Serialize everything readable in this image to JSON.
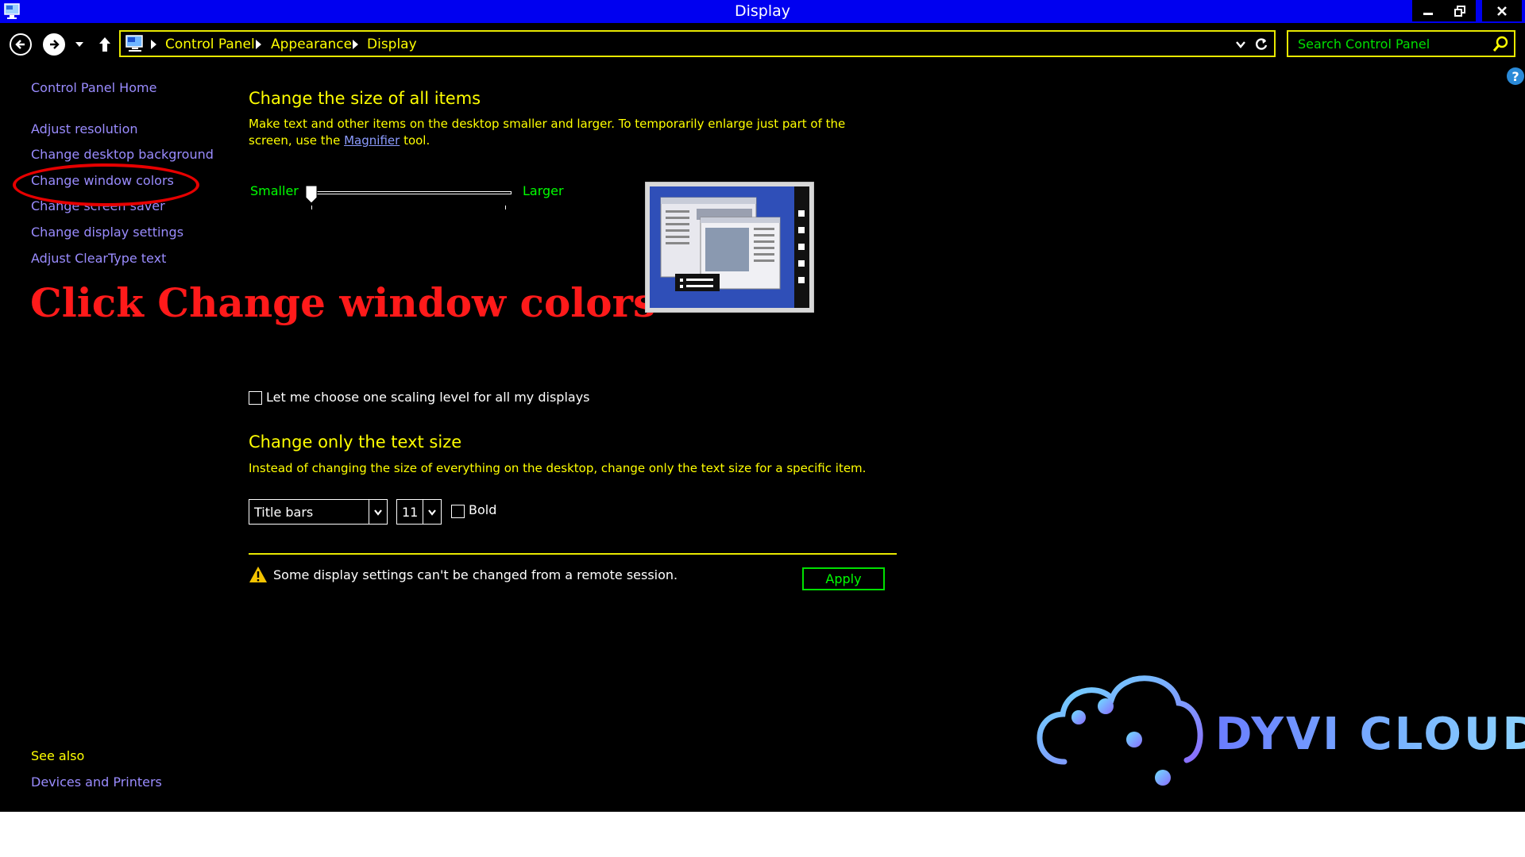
{
  "window": {
    "title": "Display",
    "controls": {
      "minimize": "minimize",
      "maximize": "restore",
      "close": "close"
    }
  },
  "navigation": {
    "breadcrumb": [
      "Control Panel",
      "Appearance",
      "Display"
    ],
    "search_placeholder": "Search Control Panel"
  },
  "sidebar": {
    "home": "Control Panel Home",
    "links": [
      "Adjust resolution",
      "Change desktop background",
      "Change window colors",
      "Change screen saver",
      "Change display settings",
      "Adjust ClearType text"
    ],
    "see_also_heading": "See also",
    "see_also_links": [
      "Devices and Printers"
    ]
  },
  "annotation": {
    "callout": "Click Change window colors",
    "highlight_color": "#e60000"
  },
  "main": {
    "size_section": {
      "heading": "Change the size of all items",
      "description_before": "Make text and other items on the desktop smaller and larger. To temporarily enlarge just part of the screen, use the ",
      "magnifier_link": "Magnifier",
      "description_after": " tool.",
      "slider_min_label": "Smaller",
      "slider_max_label": "Larger",
      "slider_level": 0
    },
    "scaling_checkbox_label": "Let me choose one scaling level for all my displays",
    "text_section": {
      "heading": "Change only the text size",
      "description": "Instead of changing the size of everything on the desktop, change only the text size for a specific item.",
      "item_select": "Title bars",
      "size_select": "11",
      "bold_label": "Bold"
    },
    "warning": "Some display settings can't be changed from a remote session.",
    "apply_button": "Apply"
  },
  "logo": {
    "text": "DYVI CLOUD"
  },
  "colors": {
    "titlebar": "#0000f0",
    "text_yellow": "#ffff00",
    "text_green": "#00ff00",
    "link_purple": "#9a8cff",
    "background": "#000000"
  }
}
